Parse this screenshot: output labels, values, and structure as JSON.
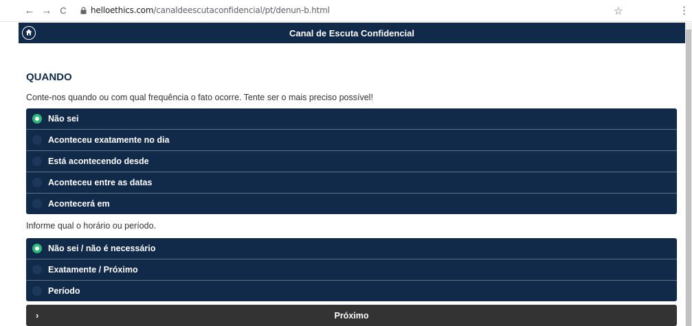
{
  "browser": {
    "back_icon": "←",
    "forward_icon": "→",
    "reload_icon": "C",
    "url_host": "helloethics.com",
    "url_path": "/canaldeescutaconfidencial/pt/denun-b.html",
    "star_icon": "☆",
    "menu_icon": "⋮"
  },
  "header": {
    "title": "Canal de Escuta Confidencial"
  },
  "section": {
    "heading": "QUANDO",
    "instruction": "Conte-nos quando ou com qual frequência o fato ocorre. Tente ser o mais preciso possível!"
  },
  "when_options": [
    {
      "label": "Não sei",
      "selected": true
    },
    {
      "label": "Aconteceu exatamente no dia",
      "selected": false
    },
    {
      "label": "Está acontecendo desde",
      "selected": false
    },
    {
      "label": "Aconteceu entre as datas",
      "selected": false
    },
    {
      "label": "Acontecerá em",
      "selected": false
    }
  ],
  "time": {
    "instruction": "Informe qual o horário ou período."
  },
  "time_options": [
    {
      "label": "Não sei / não é necessário",
      "selected": true
    },
    {
      "label": "Exatamente / Próximo",
      "selected": false
    },
    {
      "label": "Período",
      "selected": false
    }
  ],
  "next_button": {
    "chevron": "›",
    "label": "Próximo"
  },
  "colors": {
    "primary": "#112a4a",
    "selected_radio": "#2eb87a",
    "next_button": "#333333"
  }
}
